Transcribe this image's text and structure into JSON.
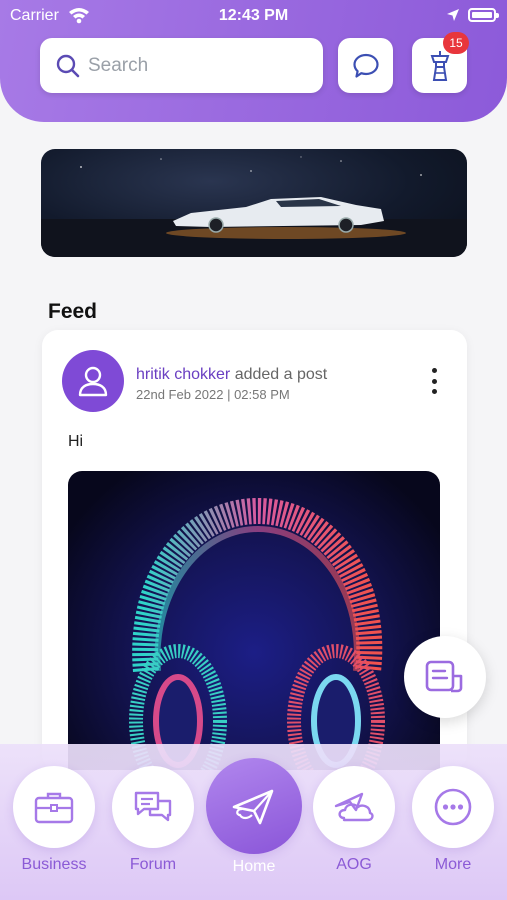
{
  "status": {
    "carrier": "Carrier",
    "time": "12:43 PM"
  },
  "search": {
    "placeholder": "Search"
  },
  "header": {
    "notification_count": "15"
  },
  "feed": {
    "title": "Feed"
  },
  "post": {
    "author": "hritik chokker",
    "action": "added a post",
    "date": "22nd Feb 2022 | 02:58 PM",
    "text": "Hi"
  },
  "nav": [
    {
      "label": "Business",
      "icon": "briefcase-icon"
    },
    {
      "label": "Forum",
      "icon": "forum-icon"
    },
    {
      "label": "Home",
      "icon": "plane-icon"
    },
    {
      "label": "AOG",
      "icon": "plane-cloud-icon"
    },
    {
      "label": "More",
      "icon": "more-icon"
    }
  ],
  "colors": {
    "accent": "#8c5ad9",
    "badge": "#e8363c"
  }
}
